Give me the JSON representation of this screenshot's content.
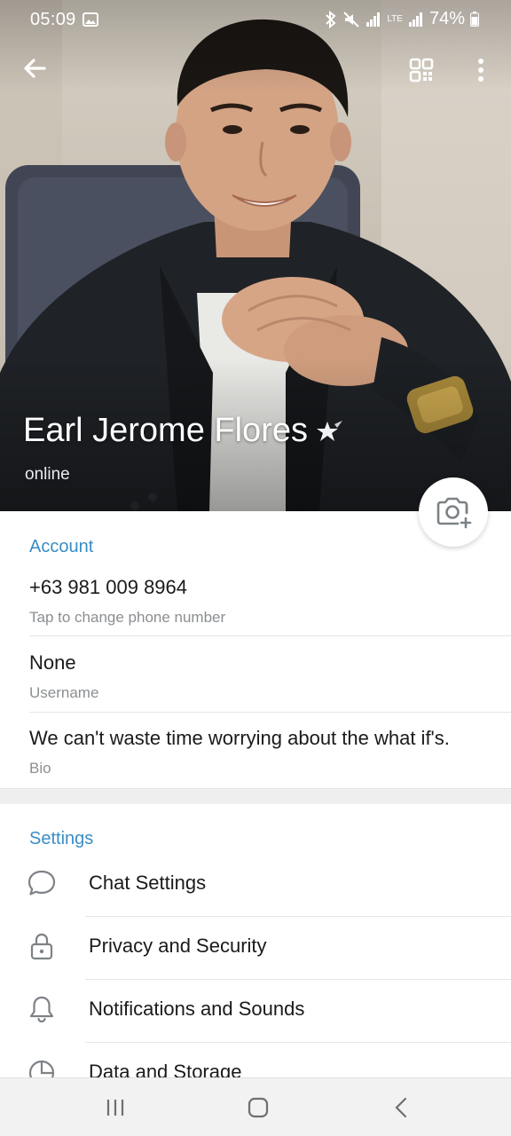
{
  "status_bar": {
    "time": "05:09",
    "battery": "74%",
    "icons": [
      "gallery-icon",
      "bluetooth-icon",
      "mute-icon",
      "signal-icon",
      "lte-icon",
      "signal-icon",
      "battery-icon"
    ],
    "lte_label": "LTE"
  },
  "header": {
    "back_icon": "arrow-left-icon",
    "qr_icon": "qr-code-icon",
    "more_icon": "more-vertical-icon",
    "name": "Earl Jerome Flores",
    "premium_icon": "premium-star-icon",
    "status": "online",
    "camera_icon": "camera-add-icon"
  },
  "account": {
    "title": "Account",
    "phone": {
      "value": "+63 981 009 8964",
      "label": "Tap to change phone number"
    },
    "username": {
      "value": "None",
      "label": "Username"
    },
    "bio": {
      "value": "We can't waste time worrying about the what if's.",
      "label": "Bio"
    }
  },
  "settings": {
    "title": "Settings",
    "items": [
      {
        "label": "Chat Settings",
        "icon": "chat-bubble-icon"
      },
      {
        "label": "Privacy and Security",
        "icon": "lock-icon"
      },
      {
        "label": "Notifications and Sounds",
        "icon": "bell-icon"
      },
      {
        "label": "Data and Storage",
        "icon": "pie-chart-icon"
      }
    ]
  },
  "navbar": {
    "recents_icon": "recents-icon",
    "home_icon": "home-icon",
    "back_icon": "nav-back-icon"
  },
  "colors": {
    "accent": "#3a8dc4",
    "text_primary": "#1a1a1a",
    "text_secondary": "#8b8e91"
  }
}
